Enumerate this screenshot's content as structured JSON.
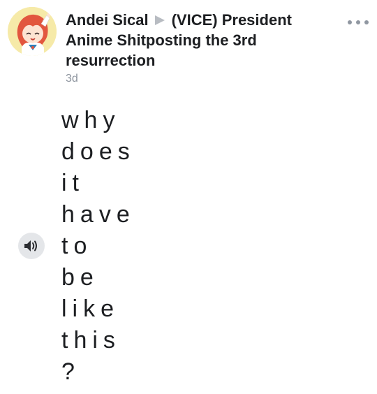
{
  "post": {
    "author": "Andei Sical",
    "group": "(VICE) President Anime Shitposting the 3rd resurrection",
    "timestamp": "3d",
    "lines": [
      "why",
      "does",
      "it",
      "have",
      "to",
      "be",
      "like",
      "this",
      "?"
    ]
  },
  "icons": {
    "avatar": "anime-girl-avatar",
    "separator": "right-triangle-arrow-icon",
    "more": "more-horizontal-icon",
    "speaker": "speaker-volume-icon"
  },
  "colors": {
    "text": "#1c1e21",
    "muted": "#8d949e",
    "arrow": "#b8bcc2",
    "speaker_bg": "#e4e6e9"
  }
}
